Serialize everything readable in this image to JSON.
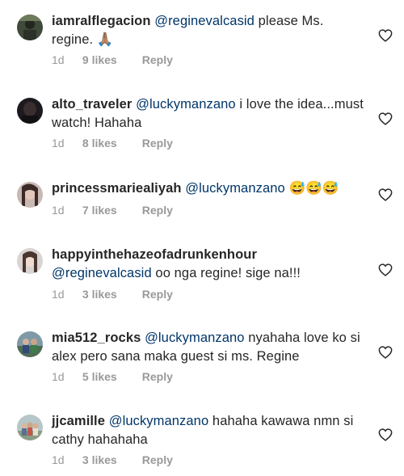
{
  "comments": [
    {
      "username": "iamralflegacion",
      "mention": "@reginevalcasid",
      "text": " please Ms. regine. ",
      "emoji": "🙏🏽",
      "time": "1d",
      "likes": "9 likes",
      "reply": "Reply"
    },
    {
      "username": "alto_traveler",
      "mention": "@luckymanzano",
      "text": " i love the idea...must watch! Hahaha",
      "time": "1d",
      "likes": "8 likes",
      "reply": "Reply"
    },
    {
      "username": "princessmariealiyah",
      "mention": "@luckymanzano",
      "text": " ",
      "emoji": "😅😅😅",
      "time": "1d",
      "likes": "7 likes",
      "reply": "Reply"
    },
    {
      "username": "happyinthehazeofadrunkenhour",
      "mention": "@reginevalcasid",
      "text": " oo nga regine! sige na!!!",
      "time": "1d",
      "likes": "3 likes",
      "reply": "Reply"
    },
    {
      "username": "mia512_rocks",
      "mention": "@luckymanzano",
      "text": " nyahaha love ko si alex pero sana maka guest si ms. Regine",
      "time": "1d",
      "likes": "5 likes",
      "reply": "Reply"
    },
    {
      "username": "jjcamille",
      "mention": "@luckymanzano",
      "text": " hahaha kawawa nmn si cathy hahahaha",
      "time": "1d",
      "likes": "3 likes",
      "reply": "Reply"
    }
  ],
  "colors": {
    "mention": "#003569",
    "meta": "#999999",
    "text": "#262626"
  },
  "icons": {
    "like": "heart-outline-icon"
  }
}
